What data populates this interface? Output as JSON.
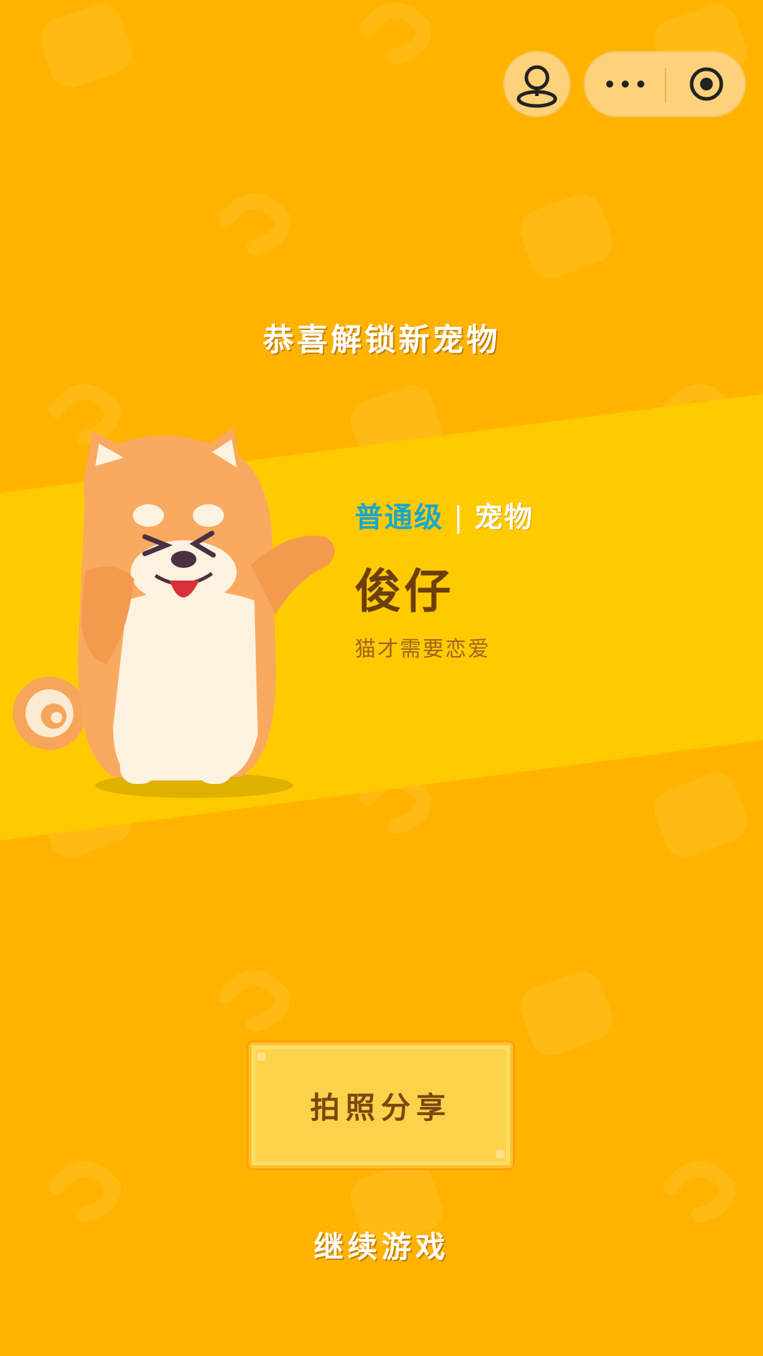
{
  "header": {
    "game_icon": "joystick-icon",
    "more_icon": "more-dots-icon",
    "close_icon": "target-icon"
  },
  "unlock": {
    "title": "恭喜解锁新宠物",
    "rarity": "普通级",
    "separator": "|",
    "type": "宠物",
    "name": "俊仔",
    "description": "猫才需要恋爱"
  },
  "actions": {
    "share_label": "拍照分享",
    "continue_label": "继续游戏"
  },
  "colors": {
    "background": "#FFB300",
    "band": "#FFCB00",
    "rarity": "#1BA6C9",
    "name": "#6B3E0C"
  }
}
